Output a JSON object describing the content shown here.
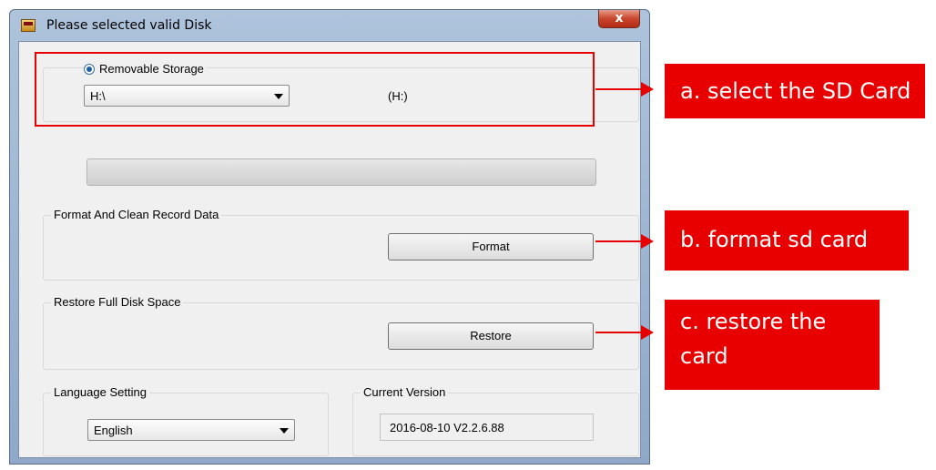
{
  "window": {
    "title": "Please selected valid Disk",
    "close_label": "x"
  },
  "storage": {
    "radio_label": "Removable Storage",
    "drive_selected": "H:\\",
    "drive_label": "(H:)"
  },
  "format_group": {
    "label": "Format And Clean Record Data",
    "button": "Format"
  },
  "restore_group": {
    "label": "Restore Full Disk Space",
    "button": "Restore"
  },
  "language_group": {
    "label": "Language Setting",
    "selected": "English"
  },
  "version_group": {
    "label": "Current Version",
    "value": "2016-08-10 V2.2.6.88"
  },
  "annotations": {
    "a": "a. select the SD Card",
    "b": "b. format sd card",
    "c_line1": "c. restore the",
    "c_line2": "card",
    "color": "#e60000"
  }
}
